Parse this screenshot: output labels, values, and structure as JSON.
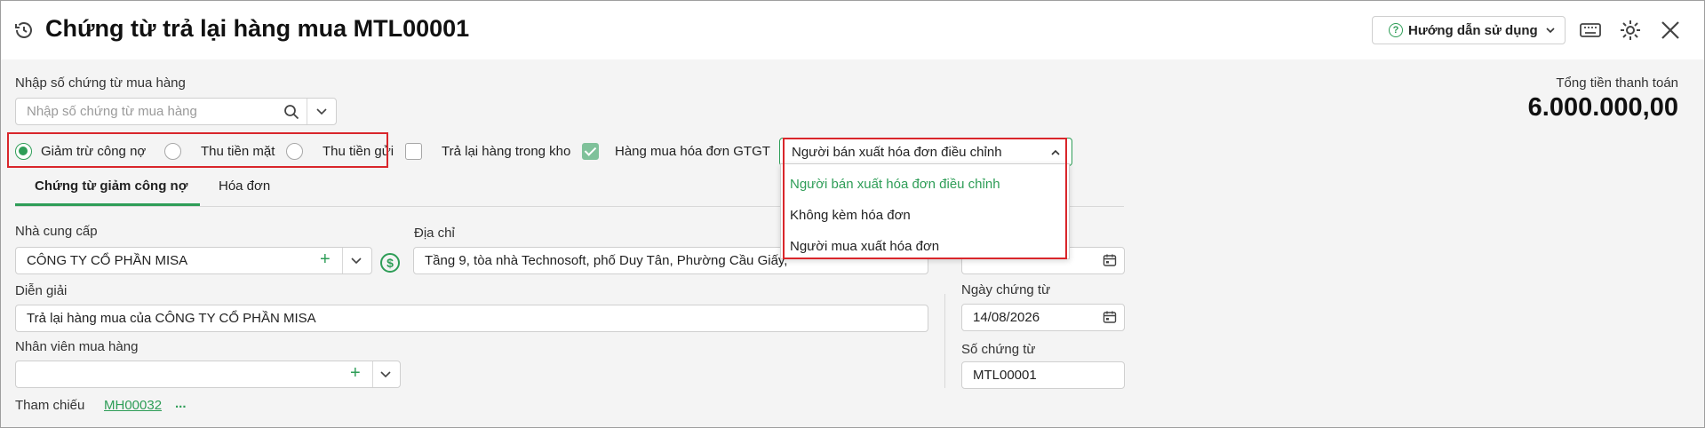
{
  "header": {
    "title": "Chứng từ trả lại hàng mua MTL00001",
    "help_label": "Hướng dẫn sử dụng"
  },
  "purchase_doc": {
    "label": "Nhập số chứng từ mua hàng",
    "placeholder": "Nhập số chứng từ mua hàng"
  },
  "total": {
    "label": "Tổng tiền thanh toán",
    "value": "6.000.000,00"
  },
  "payment_options": [
    {
      "label": "Giảm trừ công nợ",
      "checked": true
    },
    {
      "label": "Thu tiền mặt",
      "checked": false
    },
    {
      "label": "Thu tiền gửi",
      "checked": false
    }
  ],
  "checkboxes": [
    {
      "label": "Trả lại hàng trong kho",
      "checked": false
    },
    {
      "label": "Hàng mua hóa đơn GTGT",
      "checked": true
    }
  ],
  "invoice_select": {
    "value": "Người bán xuất hóa đơn điều chỉnh",
    "options": [
      "Người bán xuất hóa đơn điều chỉnh",
      "Không kèm hóa đơn",
      "Người mua xuất hóa đơn"
    ]
  },
  "tabs": [
    "Chứng từ giảm công nợ",
    "Hóa đơn"
  ],
  "form": {
    "supplier_label": "Nhà cung cấp",
    "supplier_value": "CÔNG TY CỔ PHẦN MISA",
    "address_label": "Địa chỉ",
    "address_value": "Tầng 9, tòa nhà Technosoft, phố Duy Tân, Phường Cầu Giấy,",
    "description_label": "Diễn giải",
    "description_value": "Trả lại hàng mua của CÔNG TY CỔ PHẦN MISA",
    "employee_label": "Nhân viên mua hàng",
    "employee_value": "",
    "reference_label": "Tham chiếu",
    "reference_link": "MH00032",
    "reference_more": "...",
    "doc_date_label": "Ngày chứng từ",
    "doc_date_value": "14/08/2026",
    "doc_no_label": "Số chứng từ",
    "doc_no_value": "MTL00001"
  },
  "colors": {
    "accent": "#2e9d57",
    "highlight_border": "#d9262b"
  }
}
